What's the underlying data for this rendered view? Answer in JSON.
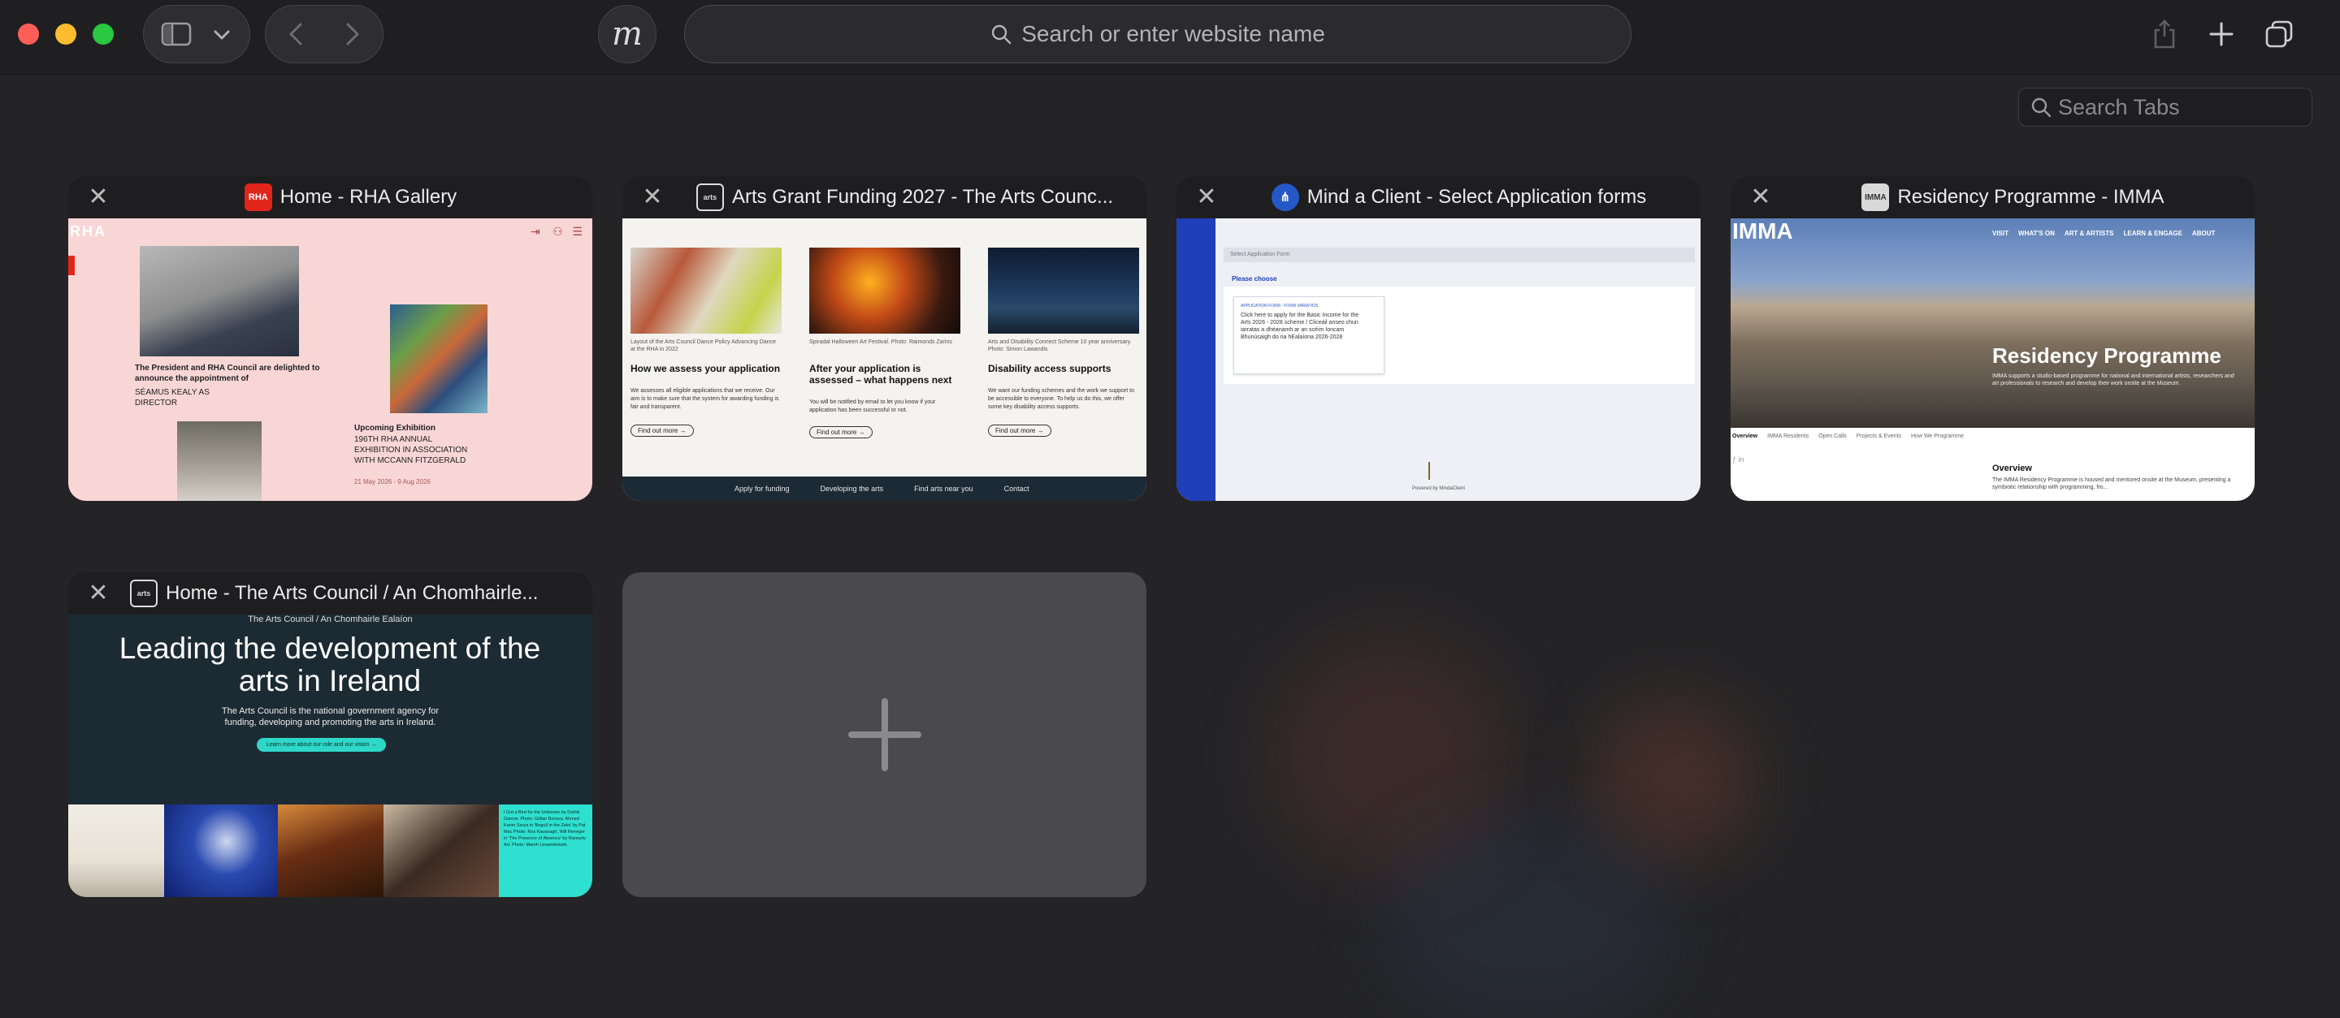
{
  "toolbar": {
    "address_placeholder": "Search or enter website name",
    "profile_letter": "m",
    "search_tabs_placeholder": "Search Tabs"
  },
  "tabs": [
    {
      "title": "Home - RHA Gallery",
      "favicon_text": "RHA",
      "favicon_color": "#e1251b",
      "preview": {
        "logo": "RHA",
        "text1": "The President and RHA Council are delighted to announce the appointment of",
        "text2": "SÉAMUS KEALY AS DIRECTOR",
        "exhibit_title": "Upcoming Exhibition",
        "exhibit_text": "196TH RHA ANNUAL EXHIBITION IN ASSOCIATION WITH MCCANN FITZGERALD",
        "exhibit_date": "21 May 2026 - 9 Aug 2026"
      }
    },
    {
      "title": "Arts Grant Funding 2027 - The Arts Counc...",
      "favicon_text": "arts",
      "favicon_color": "#1e1e20",
      "preview": {
        "col1_caption": "Layout of the Arts Council Dance Policy Advancing Dance at the RHA in 2022",
        "col1_heading": "How we assess your application",
        "col1_body": "We assesses all eligible applications that we receive. Our aim is to make sure that the system for awarding funding is fair and transparent.",
        "col2_caption": "Spiradal Halloween Art Festival. Photo: Raimonds Zarins",
        "col2_heading": "After your application is assessed – what happens next",
        "col2_body": "You will be notified by email to let you know if your application has been successful or not.",
        "col3_caption": "Arts and Disability Connect Scheme 10 year anniversary. Photo: Simon Lawandis",
        "col3_heading": "Disability access supports",
        "col3_body": "We want our funding schemes and the work we support to be accessible to everyone. To help us do this, we offer some key disability access supports.",
        "find_more": "Find out more →",
        "footer_links": [
          "Apply for funding",
          "Developing the arts",
          "Find arts near you",
          "Contact"
        ]
      }
    },
    {
      "title": "Mind a Client - Select Application forms",
      "favicon_text": "",
      "favicon_color": "#2458c6",
      "preview": {
        "select_label": "Select Application Form",
        "please_choose": "Please choose",
        "form_tag": "APPLICATION FORM - FORM VARIATIOS",
        "form_text": "Click here to apply for the Basic Income for the Arts 2026 - 2028 scheme / Cliceáil anseo chun iarratas a dhéanamh ar an scéim Ioncam Bhunúsaigh do na hEalaíona 2026-2028",
        "footer": "Powered by MindaClient"
      }
    },
    {
      "title": "Residency Programme - IMMA",
      "favicon_text": "IMMA",
      "favicon_color": "#d9d9d9",
      "preview": {
        "logo": "IMMA",
        "nav": [
          "VISIT",
          "WHAT'S ON",
          "ART & ARTISTS",
          "LEARN & ENGAGE",
          "ABOUT"
        ],
        "hero_title": "Residency Programme",
        "hero_sub": "IMMA supports a studio-based programme for national and international artists, researchers and art professionals to research and develop their work onsite at the Museum.",
        "sub_nav": [
          "Overview",
          "IMMA Residents",
          "Open Calls",
          "Projects & Events",
          "How We Programme"
        ],
        "overview_title": "Overview",
        "overview_text": "The IMMA Residency Programme is housed and mentored onsite at the Museum, presenting a symbiotic relationship with programming, fro..."
      }
    },
    {
      "title": "Home - The Arts Council / An Chomhairle...",
      "favicon_text": "arts",
      "favicon_color": "#1e1e20",
      "preview": {
        "eyebrow": "The Arts Council / An Chomhairle Ealaíon",
        "headline": "Leading the development of the arts in Ireland",
        "subtext": "The Arts Council is the national government agency for funding, developing and promoting the arts in Ireland.",
        "cta": "Learn more about our role and our vision →",
        "side_text": "I Got a Bird for the Unknown by Dubliz Dancer. Photo: Gillian Bonovy. Ahmed Karim Sarya in 'Begull in the Zaloi' by Pat Mac Photo: Ros Kavanagh. Will Reneger in 'The Presence of Absence' by Rarearty Art. Photo: Marsh Lewandowski."
      }
    }
  ],
  "new_tab": {
    "label": "+"
  }
}
